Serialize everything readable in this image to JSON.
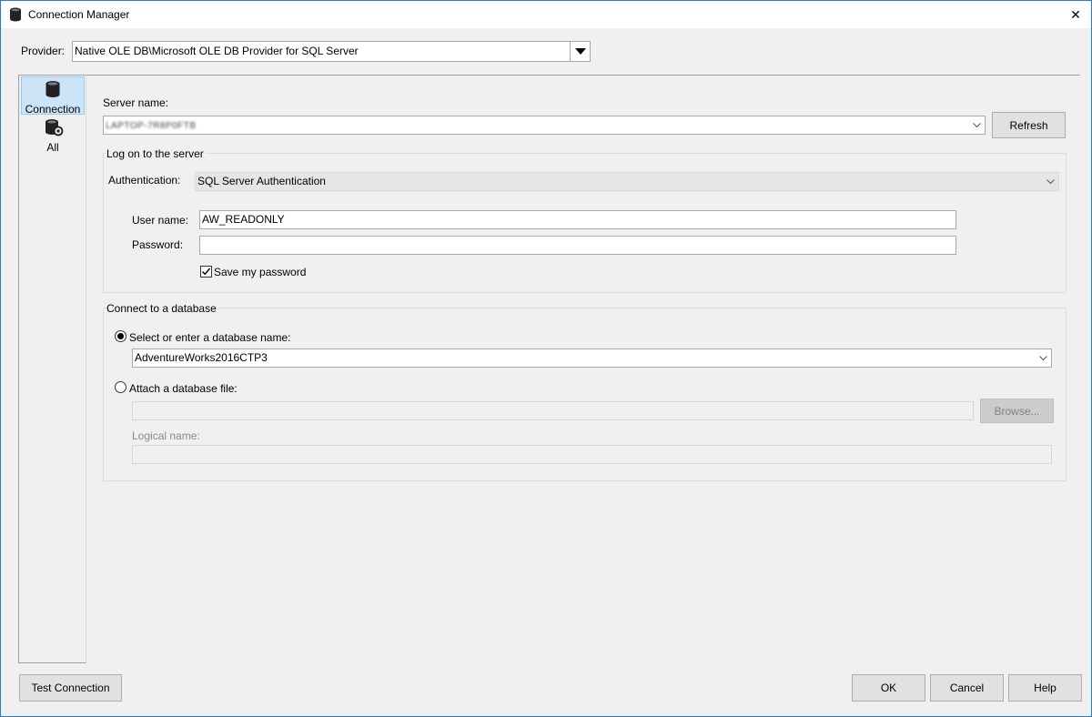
{
  "window": {
    "title": "Connection Manager",
    "close_glyph": "✕"
  },
  "provider": {
    "label": "Provider:",
    "value": "Native OLE DB\\Microsoft OLE DB Provider for SQL Server"
  },
  "nav": {
    "items": [
      {
        "label": "Connection",
        "icon": "database-icon",
        "selected": true
      },
      {
        "label": "All",
        "icon": "database-settings-icon",
        "selected": false
      }
    ]
  },
  "server": {
    "label": "Server name:",
    "value": "LAPTOP-7R8P0FTB",
    "refresh_label": "Refresh"
  },
  "logon": {
    "group_title": "Log on to the server",
    "auth_label": "Authentication:",
    "auth_value": "SQL Server Authentication",
    "username_label": "User name:",
    "username_value": "AW_READONLY",
    "password_label": "Password:",
    "password_value": "",
    "save_password_label": "Save my password",
    "save_password_checked": true
  },
  "database": {
    "group_title": "Connect to a database",
    "select_label": "Select or enter a database name:",
    "select_value": "AdventureWorks2016CTP3",
    "attach_label": "Attach a database file:",
    "attach_value": "",
    "browse_label": "Browse...",
    "logical_name_label": "Logical name:",
    "logical_name_value": "",
    "selected_option": "select"
  },
  "footer": {
    "test_connection_label": "Test Connection",
    "ok_label": "OK",
    "cancel_label": "Cancel",
    "help_label": "Help"
  }
}
